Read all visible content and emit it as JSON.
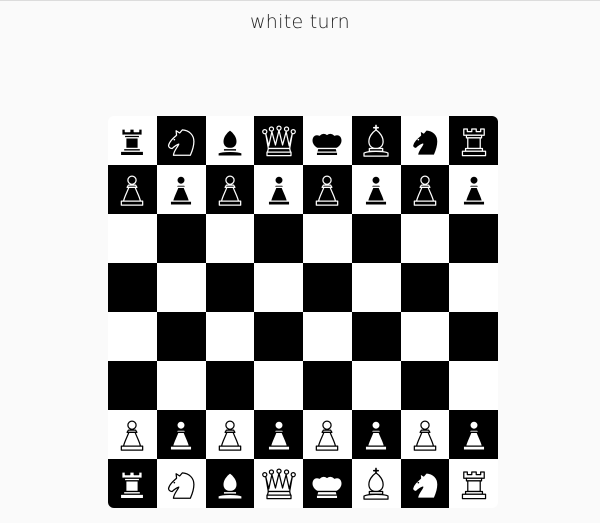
{
  "status": {
    "turn_label": "white turn"
  },
  "colors": {
    "light_square": "#ffffff",
    "dark_square": "#000000",
    "background": "#fafafa"
  },
  "board": {
    "ranks": [
      [
        "black-rook",
        "black-knight",
        "black-bishop",
        "black-queen",
        "black-king",
        "black-bishop",
        "black-knight",
        "black-rook"
      ],
      [
        "black-pawn",
        "black-pawn",
        "black-pawn",
        "black-pawn",
        "black-pawn",
        "black-pawn",
        "black-pawn",
        "black-pawn"
      ],
      [
        "",
        "",
        "",
        "",
        "",
        "",
        "",
        ""
      ],
      [
        "",
        "",
        "",
        "",
        "",
        "",
        "",
        ""
      ],
      [
        "",
        "",
        "",
        "",
        "",
        "",
        "",
        ""
      ],
      [
        "",
        "",
        "",
        "",
        "",
        "",
        "",
        ""
      ],
      [
        "white-pawn",
        "white-pawn",
        "white-pawn",
        "white-pawn",
        "white-pawn",
        "white-pawn",
        "white-pawn",
        "white-pawn"
      ],
      [
        "white-rook",
        "white-knight",
        "white-bishop",
        "white-queen",
        "white-king",
        "white-bishop",
        "white-knight",
        "white-rook"
      ]
    ]
  }
}
